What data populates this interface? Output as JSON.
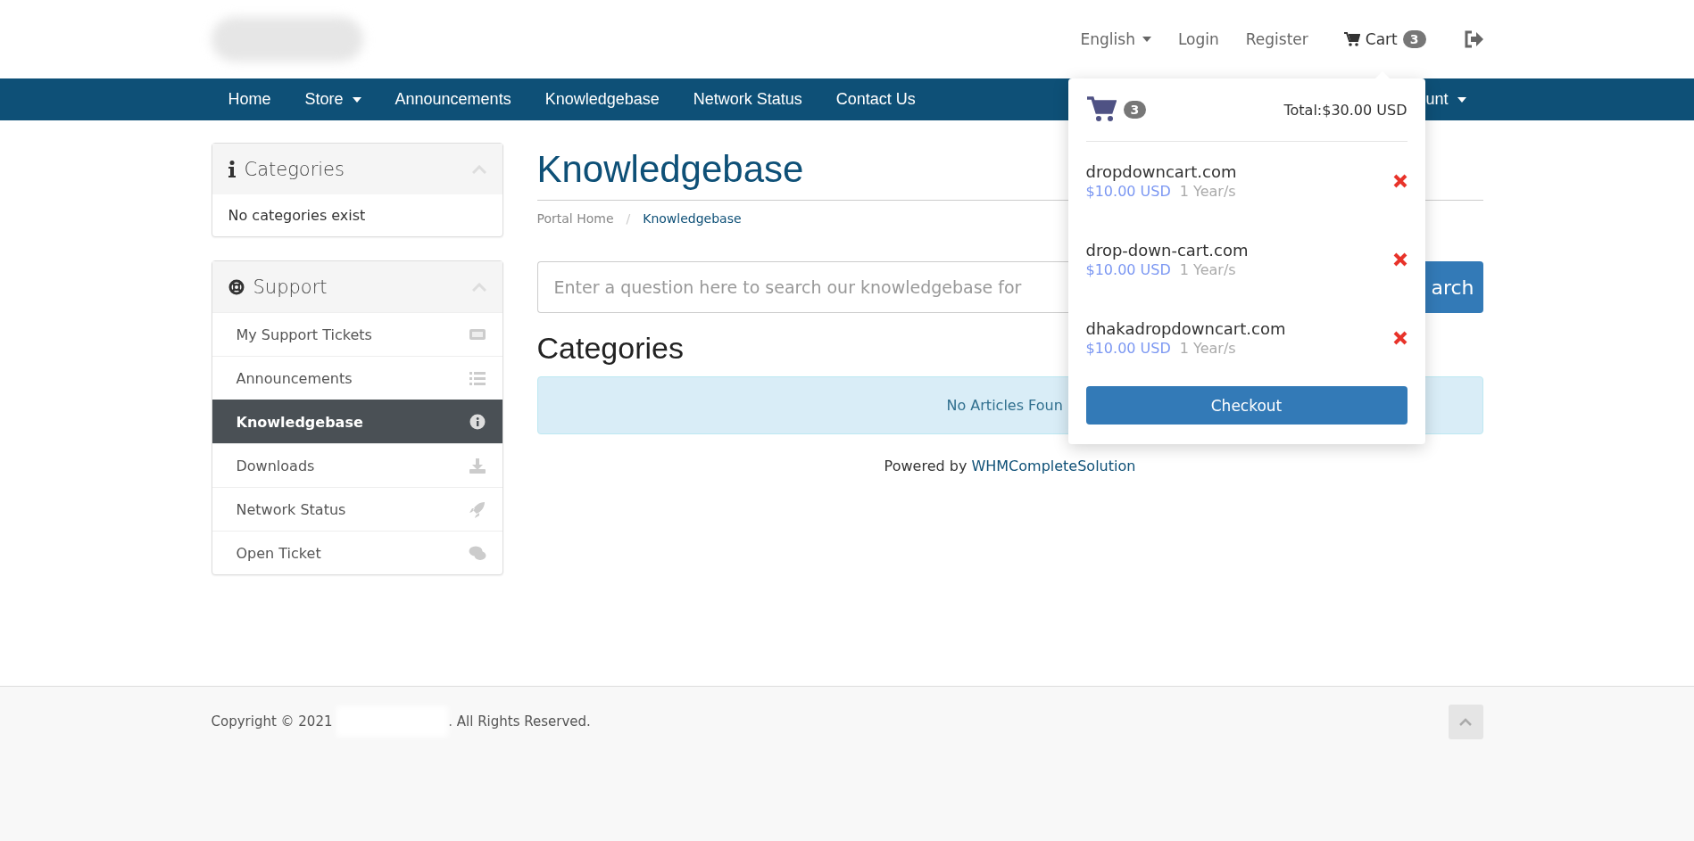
{
  "header": {
    "language": "English",
    "links": [
      "Login",
      "Register"
    ],
    "cart": {
      "label": "Cart",
      "count": "3"
    }
  },
  "nav": {
    "items": [
      {
        "label": "Home",
        "dropdown": false
      },
      {
        "label": "Store",
        "dropdown": true
      },
      {
        "label": "Announcements",
        "dropdown": false
      },
      {
        "label": "Knowledgebase",
        "dropdown": false
      },
      {
        "label": "Network Status",
        "dropdown": false
      },
      {
        "label": "Contact Us",
        "dropdown": false
      }
    ],
    "account": {
      "label": "unt",
      "dropdown": true
    }
  },
  "sidebar": {
    "categories": {
      "title": "Categories",
      "empty": "No categories exist"
    },
    "support": {
      "title": "Support",
      "items": [
        {
          "label": "My Support Tickets",
          "selected": false
        },
        {
          "label": "Announcements",
          "selected": false
        },
        {
          "label": "Knowledgebase",
          "selected": true
        },
        {
          "label": "Downloads",
          "selected": false
        },
        {
          "label": "Network Status",
          "selected": false
        },
        {
          "label": "Open Ticket",
          "selected": false
        }
      ]
    }
  },
  "main": {
    "title": "Knowledgebase",
    "breadcrumb": [
      {
        "label": "Portal Home",
        "current": false
      },
      {
        "label": "Knowledgebase",
        "current": true
      }
    ],
    "breadcrumb_separator": "/",
    "search": {
      "placeholder": "Enter a question here to search our knowledgebase for",
      "button": "arch"
    },
    "section_title": "Categories",
    "notice": "No Articles Foun",
    "powered_by": {
      "text": "Powered by",
      "link": "WHMCompleteSolution"
    }
  },
  "cart_dropdown": {
    "count": "3",
    "total": "Total:$30.00 USD",
    "items": [
      {
        "name": "dropdowncart.com",
        "price": "$10.00 USD",
        "term": "1 Year/s"
      },
      {
        "name": "drop-down-cart.com",
        "price": "$10.00 USD",
        "term": "1 Year/s"
      },
      {
        "name": "dhakadropdowncart.com",
        "price": "$10.00 USD",
        "term": "1 Year/s"
      }
    ],
    "checkout": "Checkout"
  },
  "footer": {
    "copyright": "Copyright © 2021",
    "rights": ". All Rights Reserved."
  }
}
